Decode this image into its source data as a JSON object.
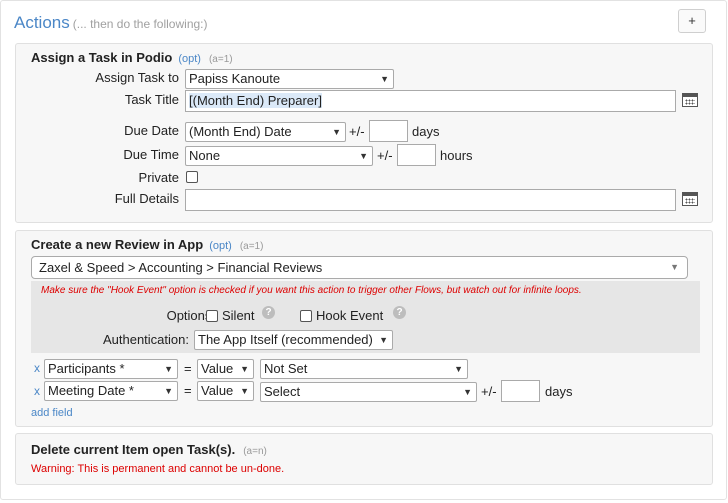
{
  "header": {
    "title": "Actions",
    "subtitle": "(... then do the following:)",
    "add_label": "+"
  },
  "task": {
    "title": "Assign a Task in Podio",
    "opt": "(opt)",
    "annot": "(a=1)",
    "assign_label": "Assign Task to",
    "assign_value": "Papiss Kanoute",
    "title_label": "Task Title",
    "title_value": "[(Month End) Preparer]",
    "due_date_label": "Due Date",
    "due_date_value": "(Month End) Date",
    "due_date_pm": "+/-",
    "due_date_unit": "days",
    "due_time_label": "Due Time",
    "due_time_value": "None",
    "due_time_pm": "+/-",
    "due_time_unit": "hours",
    "private_label": "Private",
    "details_label": "Full Details"
  },
  "review": {
    "title": "Create a new Review in App",
    "opt": "(opt)",
    "annot": "(a=1)",
    "app_path": "Zaxel & Speed > Accounting > Financial Reviews",
    "warning": "Make sure the \"Hook Event\" option is checked if you want this action to trigger other Flows, but watch out for infinite loops.",
    "options_label": "Options:",
    "silent_label": "Silent",
    "hook_label": "Hook Event",
    "auth_label": "Authentication:",
    "auth_value": "The App Itself (recommended)",
    "fields": [
      {
        "remove": "x",
        "field": "Participants *",
        "eq": "=",
        "mode": "Value",
        "value": "Not Set"
      },
      {
        "remove": "x",
        "field": "Meeting Date *",
        "eq": "=",
        "mode": "Value",
        "value": "Select",
        "pm": "+/-",
        "unit": "days"
      }
    ],
    "add_field": "add field"
  },
  "delete": {
    "title": "Delete current Item open Task(s).",
    "annot": "(a=n)",
    "warning": "Warning: This is permanent and cannot be un-done."
  }
}
